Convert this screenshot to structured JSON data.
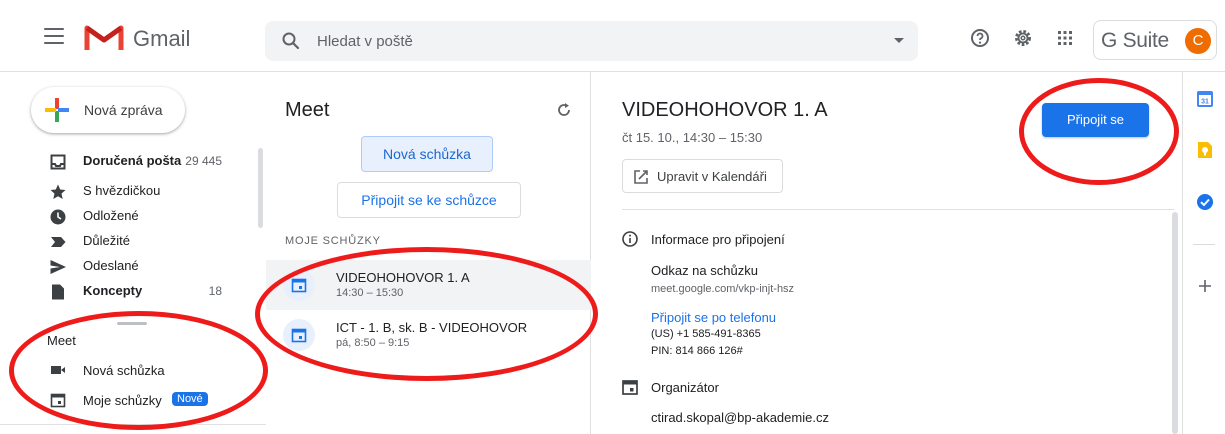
{
  "app": {
    "name": "Gmail",
    "suite_label": "G Suite",
    "avatar_letter": "C"
  },
  "search": {
    "placeholder": "Hledat v poště"
  },
  "compose": {
    "label": "Nová zpráva"
  },
  "nav": {
    "items": [
      {
        "label": "Doručená pošta",
        "count": "29 445",
        "icon": "inbox-icon"
      },
      {
        "label": "S hvězdičkou",
        "count": "",
        "icon": "star-icon"
      },
      {
        "label": "Odložené",
        "count": "",
        "icon": "clock-icon"
      },
      {
        "label": "Důležité",
        "count": "",
        "icon": "important-icon"
      },
      {
        "label": "Odeslané",
        "count": "",
        "icon": "send-icon"
      },
      {
        "label": "Koncepty",
        "count": "18",
        "icon": "draft-icon"
      }
    ]
  },
  "meet_sidebar": {
    "title": "Meet",
    "new_meeting": "Nová schůzka",
    "my_meetings": "Moje schůzky",
    "new_badge": "Nové"
  },
  "meet_panel": {
    "title": "Meet",
    "new_meeting_button": "Nová schůzka",
    "join_button": "Připojit se ke schůzce",
    "section_label": "MOJE SCHŮZKY",
    "meetings": [
      {
        "title": "VIDEOHOHOVOR 1. A",
        "time": "14:30 – 15:30"
      },
      {
        "title": "ICT - 1. B, sk. B - VIDEOHOVOR",
        "time": "pá, 8:50 – 9:15"
      }
    ]
  },
  "detail": {
    "title": "VIDEOHOHOVOR 1. A",
    "date": "čt 15. 10., 14:30 – 15:30",
    "edit_calendar": "Upravit v Kalendáři",
    "join_button": "Připojit se",
    "info_heading": "Informace pro připojení",
    "link_heading": "Odkaz na schůzku",
    "link_url": "meet.google.com/vkp-injt-hsz",
    "phone_link": "Připojit se po telefonu",
    "phone_number": "(US) +1 585-491-8365",
    "pin": "PIN: 814 866 126#",
    "organizer_heading": "Organizátor",
    "organizer_email": "ctirad.skopal@bp-akademie.cz"
  },
  "colors": {
    "accent": "#1a73e8",
    "annotation": "#ee1b1b",
    "gmail_red": "#ea4335"
  }
}
